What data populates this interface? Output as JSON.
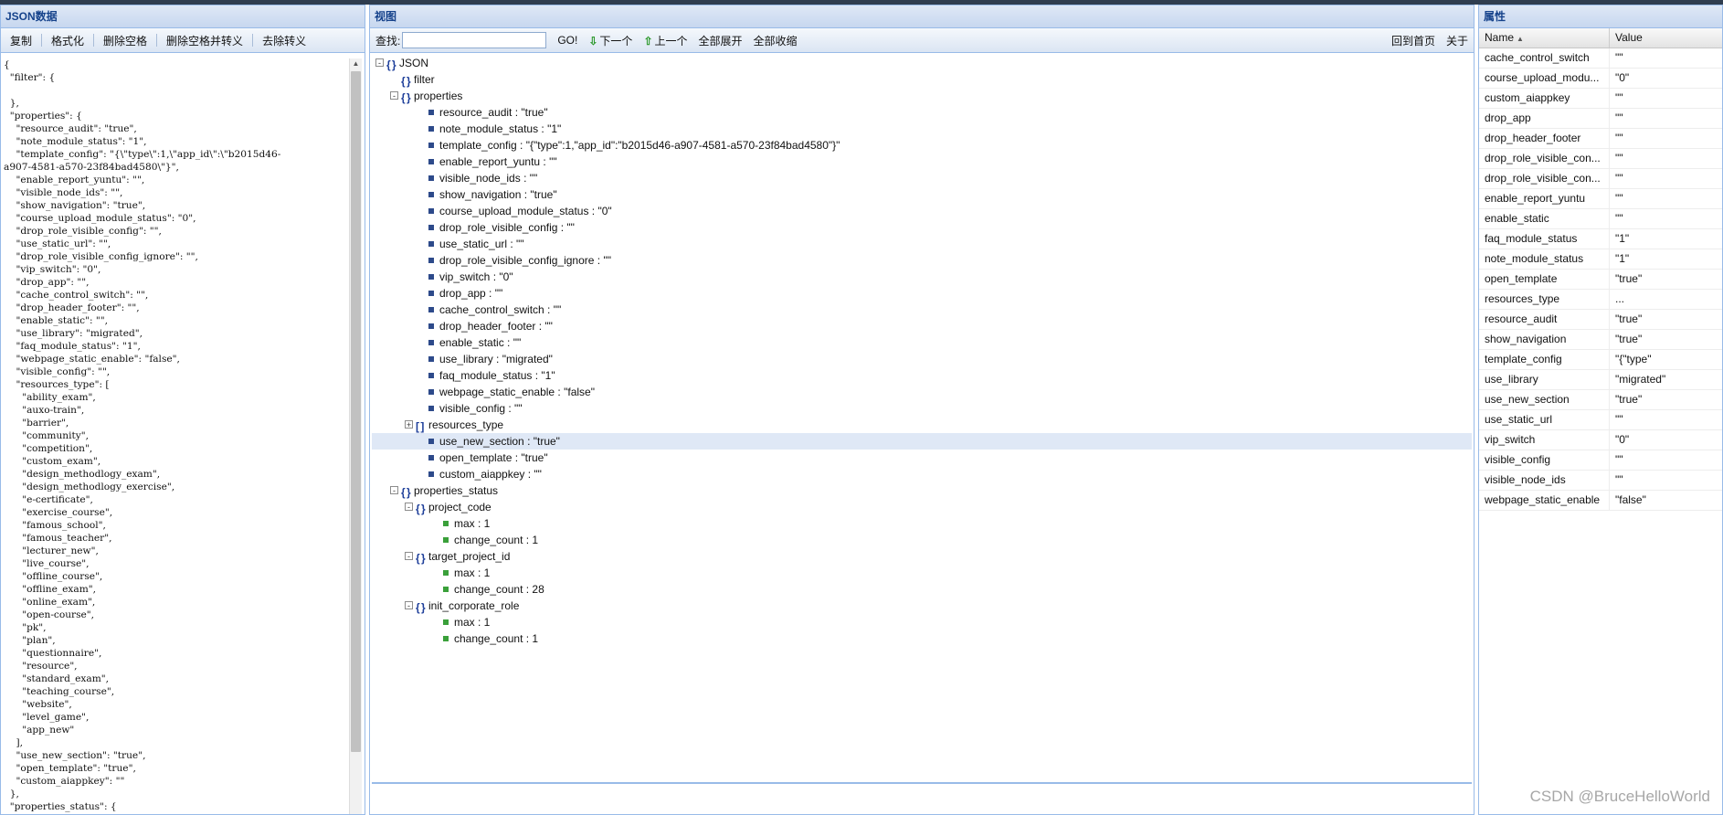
{
  "left_panel": {
    "title": "JSON数据",
    "toolbar": {
      "copy": "复制",
      "format": "格式化",
      "remove_space": "删除空格",
      "remove_space_escape": "删除空格并转义",
      "unescape": "去除转义"
    },
    "json_text": "{\n  \"filter\": {\n\n  },\n  \"properties\": {\n    \"resource_audit\": \"true\",\n    \"note_module_status\": \"1\",\n    \"template_config\": \"{\\\"type\\\":1,\\\"app_id\\\":\\\"b2015d46-\na907-4581-a570-23f84bad4580\\\"}\",\n    \"enable_report_yuntu\": \"\",\n    \"visible_node_ids\": \"\",\n    \"show_navigation\": \"true\",\n    \"course_upload_module_status\": \"0\",\n    \"drop_role_visible_config\": \"\",\n    \"use_static_url\": \"\",\n    \"drop_role_visible_config_ignore\": \"\",\n    \"vip_switch\": \"0\",\n    \"drop_app\": \"\",\n    \"cache_control_switch\": \"\",\n    \"drop_header_footer\": \"\",\n    \"enable_static\": \"\",\n    \"use_library\": \"migrated\",\n    \"faq_module_status\": \"1\",\n    \"webpage_static_enable\": \"false\",\n    \"visible_config\": \"\",\n    \"resources_type\": [\n      \"ability_exam\",\n      \"auxo-train\",\n      \"barrier\",\n      \"community\",\n      \"competition\",\n      \"custom_exam\",\n      \"design_methodlogy_exam\",\n      \"design_methodlogy_exercise\",\n      \"e-certificate\",\n      \"exercise_course\",\n      \"famous_school\",\n      \"famous_teacher\",\n      \"lecturer_new\",\n      \"live_course\",\n      \"offline_course\",\n      \"offline_exam\",\n      \"online_exam\",\n      \"open-course\",\n      \"pk\",\n      \"plan\",\n      \"questionnaire\",\n      \"resource\",\n      \"standard_exam\",\n      \"teaching_course\",\n      \"website\",\n      \"level_game\",\n      \"app_new\"\n    ],\n    \"use_new_section\": \"true\",\n    \"open_template\": \"true\",\n    \"custom_aiappkey\": \"\"\n  },\n  \"properties_status\": {\n    \"project_code\": {"
  },
  "mid_panel": {
    "title": "视图",
    "toolbar": {
      "find_label": "查找:",
      "find_value": "",
      "go": "GO!",
      "next": "下一个",
      "prev": "上一个",
      "expand_all": "全部展开",
      "collapse_all": "全部收缩",
      "home": "回到首页",
      "about": "关于"
    },
    "tree": [
      {
        "label": "JSON",
        "depth": 0,
        "kind": "obj",
        "exp": "-"
      },
      {
        "label": "filter",
        "depth": 1,
        "kind": "obj",
        "exp": ""
      },
      {
        "label": "properties",
        "depth": 1,
        "kind": "obj",
        "exp": "-"
      },
      {
        "label": "resource_audit : \"true\"",
        "depth": 2,
        "kind": "leaf"
      },
      {
        "label": "note_module_status : \"1\"",
        "depth": 2,
        "kind": "leaf"
      },
      {
        "label": "template_config : \"{\"type\":1,\"app_id\":\"b2015d46-a907-4581-a570-23f84bad4580\"}\"",
        "depth": 2,
        "kind": "leaf"
      },
      {
        "label": "enable_report_yuntu : \"\"",
        "depth": 2,
        "kind": "leaf"
      },
      {
        "label": "visible_node_ids : \"\"",
        "depth": 2,
        "kind": "leaf"
      },
      {
        "label": "show_navigation : \"true\"",
        "depth": 2,
        "kind": "leaf"
      },
      {
        "label": "course_upload_module_status : \"0\"",
        "depth": 2,
        "kind": "leaf"
      },
      {
        "label": "drop_role_visible_config : \"\"",
        "depth": 2,
        "kind": "leaf"
      },
      {
        "label": "use_static_url : \"\"",
        "depth": 2,
        "kind": "leaf"
      },
      {
        "label": "drop_role_visible_config_ignore : \"\"",
        "depth": 2,
        "kind": "leaf"
      },
      {
        "label": "vip_switch : \"0\"",
        "depth": 2,
        "kind": "leaf"
      },
      {
        "label": "drop_app : \"\"",
        "depth": 2,
        "kind": "leaf"
      },
      {
        "label": "cache_control_switch : \"\"",
        "depth": 2,
        "kind": "leaf"
      },
      {
        "label": "drop_header_footer : \"\"",
        "depth": 2,
        "kind": "leaf"
      },
      {
        "label": "enable_static : \"\"",
        "depth": 2,
        "kind": "leaf"
      },
      {
        "label": "use_library : \"migrated\"",
        "depth": 2,
        "kind": "leaf"
      },
      {
        "label": "faq_module_status : \"1\"",
        "depth": 2,
        "kind": "leaf"
      },
      {
        "label": "webpage_static_enable : \"false\"",
        "depth": 2,
        "kind": "leaf"
      },
      {
        "label": "visible_config : \"\"",
        "depth": 2,
        "kind": "leaf"
      },
      {
        "label": "resources_type",
        "depth": 2,
        "kind": "arr",
        "exp": "+"
      },
      {
        "label": "use_new_section : \"true\"",
        "depth": 2,
        "kind": "leaf",
        "selected": true
      },
      {
        "label": "open_template : \"true\"",
        "depth": 2,
        "kind": "leaf"
      },
      {
        "label": "custom_aiappkey : \"\"",
        "depth": 2,
        "kind": "leaf"
      },
      {
        "label": "properties_status",
        "depth": 1,
        "kind": "obj",
        "exp": "-"
      },
      {
        "label": "project_code",
        "depth": 2,
        "kind": "obj",
        "exp": "-"
      },
      {
        "label": "max : 1",
        "depth": 3,
        "kind": "leaf",
        "green": true
      },
      {
        "label": "change_count : 1",
        "depth": 3,
        "kind": "leaf",
        "green": true
      },
      {
        "label": "target_project_id",
        "depth": 2,
        "kind": "obj",
        "exp": "-"
      },
      {
        "label": "max : 1",
        "depth": 3,
        "kind": "leaf",
        "green": true
      },
      {
        "label": "change_count : 28",
        "depth": 3,
        "kind": "leaf",
        "green": true
      },
      {
        "label": "init_corporate_role",
        "depth": 2,
        "kind": "obj",
        "exp": "-"
      },
      {
        "label": "max : 1",
        "depth": 3,
        "kind": "leaf",
        "green": true
      },
      {
        "label": "change_count : 1",
        "depth": 3,
        "kind": "leaf",
        "green": true
      }
    ]
  },
  "right_panel": {
    "title": "属性",
    "col_name": "Name",
    "col_value": "Value",
    "rows": [
      {
        "name": "cache_control_switch",
        "value": "\"\""
      },
      {
        "name": "course_upload_modu...",
        "value": "\"0\""
      },
      {
        "name": "custom_aiappkey",
        "value": "\"\""
      },
      {
        "name": "drop_app",
        "value": "\"\""
      },
      {
        "name": "drop_header_footer",
        "value": "\"\""
      },
      {
        "name": "drop_role_visible_con...",
        "value": "\"\""
      },
      {
        "name": "drop_role_visible_con...",
        "value": "\"\""
      },
      {
        "name": "enable_report_yuntu",
        "value": "\"\""
      },
      {
        "name": "enable_static",
        "value": "\"\""
      },
      {
        "name": "faq_module_status",
        "value": "\"1\""
      },
      {
        "name": "note_module_status",
        "value": "\"1\""
      },
      {
        "name": "open_template",
        "value": "\"true\""
      },
      {
        "name": "resources_type",
        "value": "..."
      },
      {
        "name": "resource_audit",
        "value": "\"true\""
      },
      {
        "name": "show_navigation",
        "value": "\"true\""
      },
      {
        "name": "template_config",
        "value": "\"{\"type\""
      },
      {
        "name": "use_library",
        "value": "\"migrated\""
      },
      {
        "name": "use_new_section",
        "value": "\"true\""
      },
      {
        "name": "use_static_url",
        "value": "\"\""
      },
      {
        "name": "vip_switch",
        "value": "\"0\""
      },
      {
        "name": "visible_config",
        "value": "\"\""
      },
      {
        "name": "visible_node_ids",
        "value": "\"\""
      },
      {
        "name": "webpage_static_enable",
        "value": "\"false\""
      }
    ]
  },
  "watermark": "CSDN @BruceHelloWorld"
}
